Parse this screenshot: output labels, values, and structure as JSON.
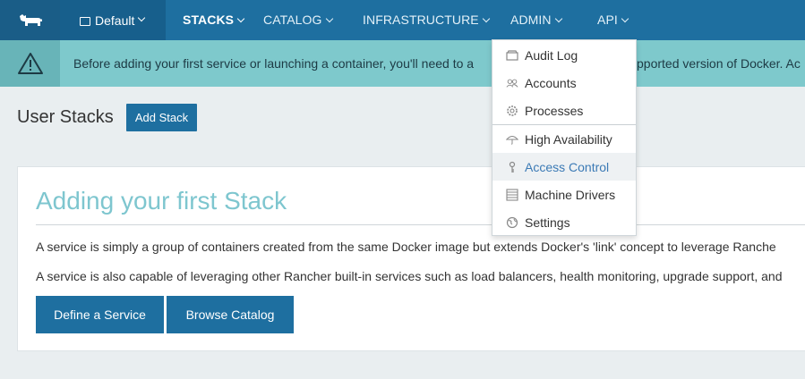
{
  "nav": {
    "environment": "Default",
    "items": [
      "STACKS",
      "CATALOG",
      "INFRASTRUCTURE",
      "ADMIN",
      "API"
    ],
    "active": "STACKS"
  },
  "banner": {
    "text_left": "Before adding your first service or launching a container, you'll need to a",
    "text_right": "pported version of Docker. Ac"
  },
  "page": {
    "title": "User Stacks",
    "add_button": "Add Stack"
  },
  "card": {
    "title": "Adding your first Stack",
    "p1": "A service is simply a group of containers created from the same Docker image but extends Docker's 'link' concept to leverage Ranche",
    "p2": "A service is also capable of leveraging other Rancher built-in services such as load balancers, health monitoring, upgrade support, and",
    "buttons": [
      "Define a Service",
      "Browse Catalog"
    ]
  },
  "admin_menu": {
    "items": [
      {
        "label": "Audit Log",
        "icon": "audit-log-icon"
      },
      {
        "label": "Accounts",
        "icon": "accounts-icon"
      },
      {
        "label": "Processes",
        "icon": "processes-gear-icon"
      },
      {
        "label": "High Availability",
        "icon": "umbrella-icon"
      },
      {
        "label": "Access Control",
        "icon": "key-icon"
      },
      {
        "label": "Machine Drivers",
        "icon": "server-stack-icon"
      },
      {
        "label": "Settings",
        "icon": "globe-icon"
      }
    ],
    "hovered": "Access Control"
  },
  "colors": {
    "nav_bg": "#1e6fa0",
    "banner_bg": "#7ec9cc",
    "card_title": "#7ec6cf",
    "hover_text": "#3b7ab5"
  }
}
